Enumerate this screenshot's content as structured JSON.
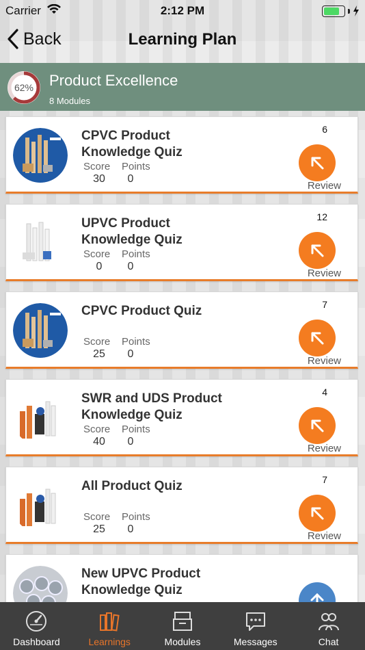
{
  "status_bar": {
    "carrier": "Carrier",
    "time": "2:12 PM"
  },
  "nav": {
    "back_label": "Back",
    "title": "Learning Plan"
  },
  "plan": {
    "progress_text": "62%",
    "progress": 0.62,
    "title": "Product Excellence",
    "subtitle": "8 Modules"
  },
  "labels": {
    "score": "Score",
    "points": "Points",
    "review": "Review"
  },
  "modules": [
    {
      "title_line1": "CPVC Product",
      "title_line2": "Knowledge Quiz",
      "score": "30",
      "points": "0",
      "count": "6",
      "thumb": "cpvc"
    },
    {
      "title_line1": "UPVC Product",
      "title_line2": "Knowledge Quiz",
      "score": "0",
      "points": "0",
      "count": "12",
      "thumb": "upvc"
    },
    {
      "title_line1": "CPVC Product Quiz",
      "title_line2": "",
      "score": "25",
      "points": "0",
      "count": "7",
      "thumb": "cpvc"
    },
    {
      "title_line1": "SWR and UDS Product",
      "title_line2": "Knowledge Quiz",
      "score": "40",
      "points": "0",
      "count": "4",
      "thumb": "swr"
    },
    {
      "title_line1": "All Product Quiz",
      "title_line2": "",
      "score": "25",
      "points": "0",
      "count": "7",
      "thumb": "swr"
    },
    {
      "title_line1": "New UPVC Product",
      "title_line2": "Knowledge Quiz",
      "score": "",
      "points": "",
      "count": "",
      "thumb": "pipes"
    }
  ],
  "tabs": [
    {
      "label": "Dashboard",
      "icon": "speedometer-icon"
    },
    {
      "label": "Learnings",
      "icon": "binders-icon"
    },
    {
      "label": "Modules",
      "icon": "archive-icon"
    },
    {
      "label": "Messages",
      "icon": "chat-bubble-icon"
    },
    {
      "label": "Chat",
      "icon": "people-icon"
    }
  ],
  "colors": {
    "accent": "#e8752a",
    "header": "#6f8f7e",
    "progress": "#a63a3a",
    "tabbar": "#3f3f3f"
  }
}
